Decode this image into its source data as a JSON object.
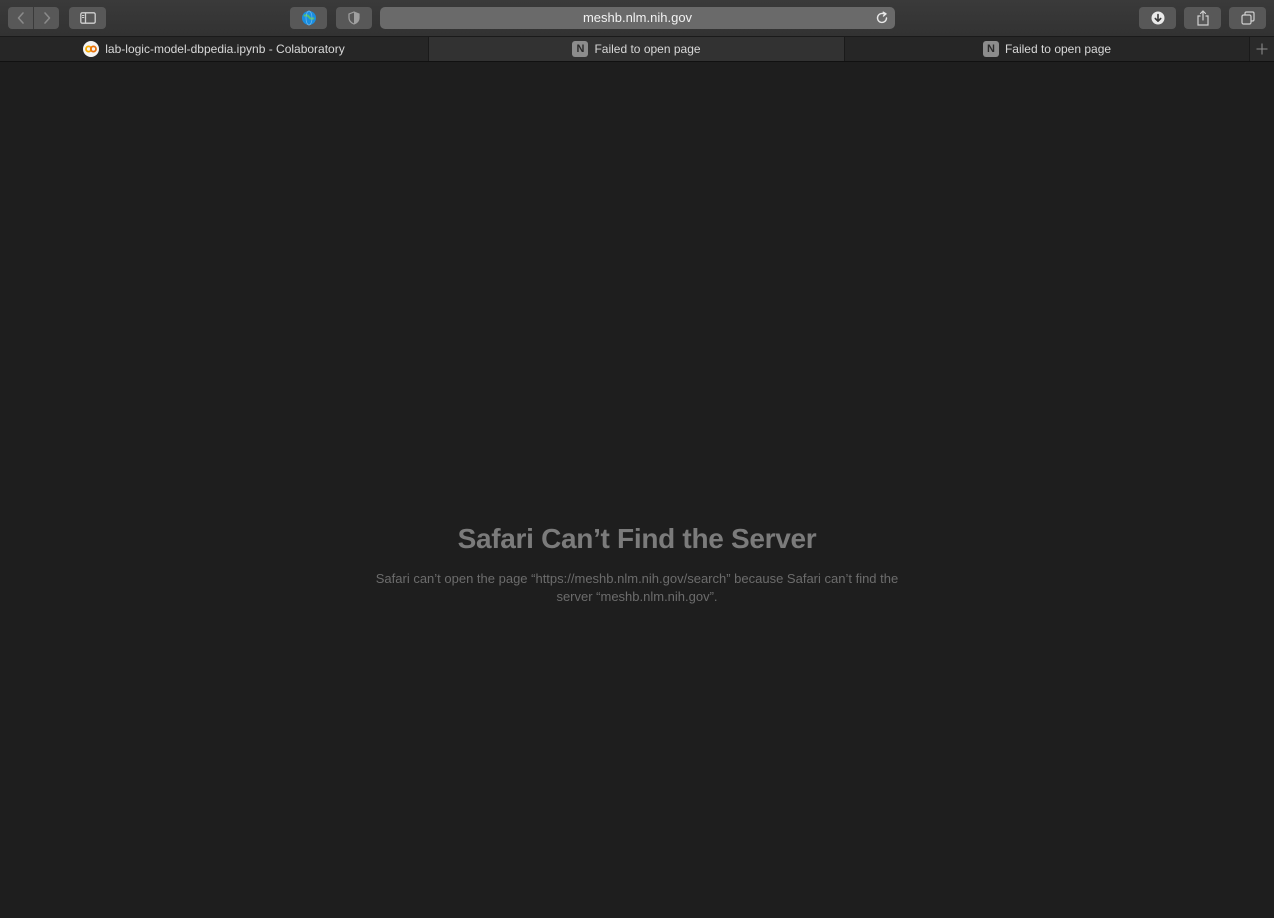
{
  "toolbar": {
    "address_url": "meshb.nlm.nih.gov",
    "icons": {
      "back": "chevron-left-icon",
      "forward": "chevron-right-icon",
      "sidebar": "sidebar-icon",
      "site_globe": "globe-icon",
      "privacy": "shield-icon",
      "reload": "reload-icon",
      "downloads": "download-icon",
      "share": "share-icon",
      "tabs_overview": "tabs-overview-icon",
      "new_tab": "plus-icon"
    }
  },
  "tabs": [
    {
      "title": "lab-logic-model-dbpedia.ipynb - Colaboratory",
      "favicon": "colab-logo-icon",
      "active": false
    },
    {
      "title": "Failed to open page",
      "favicon": "N",
      "active": true
    },
    {
      "title": "Failed to open page",
      "favicon": "N",
      "active": false
    }
  ],
  "error": {
    "title": "Safari Can’t Find the Server",
    "message": "Safari can’t open the page “https://meshb.nlm.nih.gov/search” because Safari can’t find the server “meshb.nlm.nih.gov”."
  },
  "colors": {
    "page_background": "#1e1e1e",
    "toolbar_background": "#353535",
    "accent_globe": "#1a8ee0",
    "colab_orange": "#f9ab00"
  }
}
